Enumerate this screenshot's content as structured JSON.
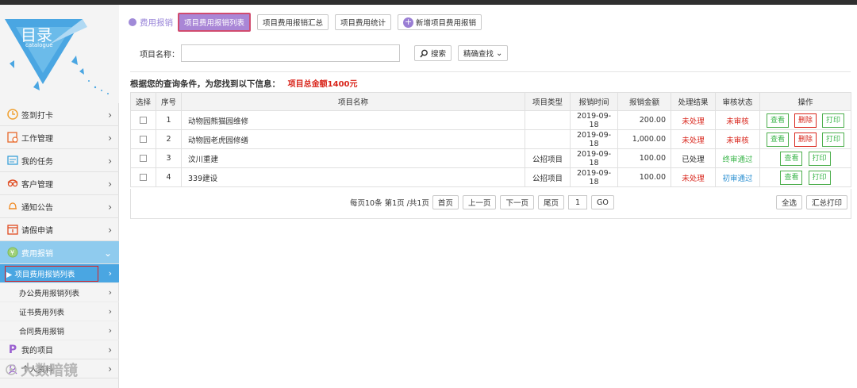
{
  "sidebar": {
    "logo_title": "目录",
    "logo_sub": "catalogue",
    "items": [
      {
        "label": "签到打卡",
        "icon": "clock-icon"
      },
      {
        "label": "工作管理",
        "icon": "worksheet-icon"
      },
      {
        "label": "我的任务",
        "icon": "task-icon"
      },
      {
        "label": "客户管理",
        "icon": "customers-icon"
      },
      {
        "label": "通知公告",
        "icon": "bell-icon"
      },
      {
        "label": "请假申请",
        "icon": "calendar-icon"
      },
      {
        "label": "费用报销",
        "icon": "money-icon"
      }
    ],
    "sub_items": [
      {
        "label": "▶ 项目费用报销列表"
      },
      {
        "label": "办公费用报销列表"
      },
      {
        "label": "证书费用列表"
      },
      {
        "label": "合同费用报销"
      }
    ],
    "after_items": [
      {
        "label": "我的项目",
        "icon": "p-icon"
      },
      {
        "label": "个人资料",
        "icon": "user-icon"
      }
    ]
  },
  "header": {
    "section_label": "费用报销",
    "tabs": [
      "项目费用报销列表",
      "项目费用报销汇总",
      "项目费用统计"
    ],
    "add_label": "新增项目费用报销"
  },
  "search": {
    "label": "项目名称：",
    "value": "",
    "search_btn": "搜索",
    "advanced_btn": "精确查找"
  },
  "result": {
    "text": "根据您的查询条件，为您找到以下信息：",
    "total": "项目总金额1400元"
  },
  "table": {
    "headers": [
      "选择",
      "序号",
      "项目名称",
      "项目类型",
      "报销时间",
      "报销金额",
      "处理结果",
      "审核状态",
      "操作"
    ],
    "rows": [
      {
        "no": "1",
        "name": "动物园熊猫园维修",
        "type": "",
        "date": "2019-09-18",
        "amount": "200.00",
        "result": "未处理",
        "status": "未审核",
        "ops": [
          "查看",
          "删除",
          "打印"
        ]
      },
      {
        "no": "2",
        "name": "动物园老虎园修缮",
        "type": "",
        "date": "2019-09-18",
        "amount": "1,000.00",
        "result": "未处理",
        "status": "未审核",
        "ops": [
          "查看",
          "删除",
          "打印"
        ]
      },
      {
        "no": "3",
        "name": "汶川重建",
        "type": "公招项目",
        "date": "2019-09-18",
        "amount": "100.00",
        "result": "已处理",
        "status": "终审通过",
        "ops": [
          "查看",
          "打印"
        ]
      },
      {
        "no": "4",
        "name": "339建设",
        "type": "公招项目",
        "date": "2019-09-18",
        "amount": "100.00",
        "result": "未处理",
        "status": "初审通过",
        "ops": [
          "查看",
          "打印"
        ]
      }
    ]
  },
  "pager": {
    "info": "每页10条 第1页 /共1页",
    "first": "首页",
    "prev": "上一页",
    "next": "下一页",
    "last": "尾页",
    "page_input": "1",
    "go": "GO",
    "select_all": "全选",
    "print_summary": "汇总打印"
  },
  "watermark": "大数暗镜",
  "colors": {
    "accent": "#a986d6",
    "active_nav": "#8fcbee",
    "selected_sub": "#4aa6e2",
    "red": "#d9261c",
    "green": "#3ab54a",
    "blue": "#2a8fd1"
  }
}
